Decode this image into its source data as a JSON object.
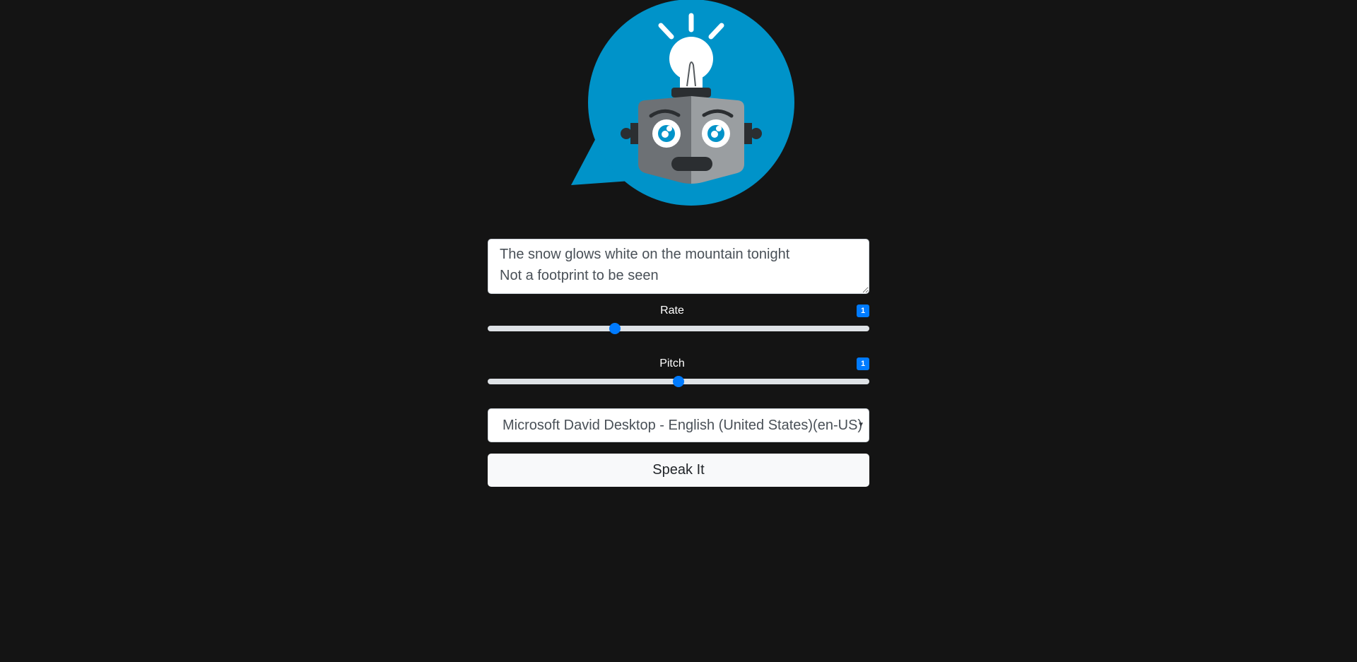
{
  "logo": {
    "icon": "robot-lightbulb-speech-bubble-logo",
    "bubble_color": "#0093c9"
  },
  "form": {
    "text_value": "The snow glows white on the mountain tonight\nNot a footprint to be seen",
    "rate": {
      "label": "Rate",
      "badge": "1",
      "value": 1,
      "min": 0.5,
      "max": 2
    },
    "pitch": {
      "label": "Pitch",
      "badge": "1",
      "value": 1,
      "min": 0,
      "max": 2
    },
    "voice_select": {
      "selected": "Microsoft David Desktop - English (United States)(en-US)"
    },
    "speak_button": "Speak It"
  },
  "colors": {
    "background": "#141414",
    "accent": "#007bff"
  }
}
